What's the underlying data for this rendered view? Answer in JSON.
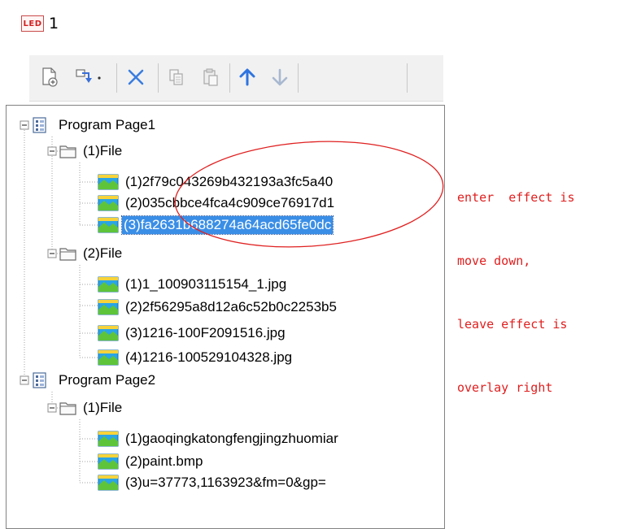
{
  "led": {
    "icon_text": "LED",
    "number": "1"
  },
  "toolbar": {
    "buttons": [
      {
        "name": "new-page-button",
        "icon": "new-page-icon"
      },
      {
        "name": "add-dropdown-button",
        "icon": "add-item-icon"
      },
      {
        "name": "delete-button",
        "icon": "close-icon"
      },
      {
        "name": "copy-button",
        "icon": "copy-icon"
      },
      {
        "name": "paste-button",
        "icon": "paste-icon"
      },
      {
        "name": "move-up-button",
        "icon": "arrow-up-icon"
      },
      {
        "name": "move-down-button",
        "icon": "arrow-down-icon"
      }
    ]
  },
  "tree": {
    "page1": "Program Page1",
    "page1_file1": "(1)File",
    "page1_file1_items": [
      "(1)2f79c043269b432193a3fc5a40",
      "(2)035cbbce4fca4c909ce76917d1",
      "(3)fa2631b688274a64acd65fe0dc"
    ],
    "page1_file2": "(2)File",
    "page1_file2_items": [
      "(1)1_100903115154_1.jpg",
      "(2)2f56295a8d12a6c52b0c2253b5",
      "(3)1216-100F2091516.jpg",
      "(4)1216-100529104328.jpg"
    ],
    "page2": "Program Page2",
    "page2_file1": "(1)File",
    "page2_file1_items": [
      "(1)gaoqingkatongfengjingzhuomiar",
      "(2)paint.bmp",
      "(3)u=37773,1163923&fm=0&gp="
    ]
  },
  "annotation": {
    "line1": "enter  effect is",
    "line2": "move down,",
    "line3": "leave effect is",
    "line4": "overlay right"
  },
  "colors": {
    "selection": "#3a8ee6",
    "annotation": "#e01e1e",
    "tree_lines": "#a0a0a0"
  }
}
